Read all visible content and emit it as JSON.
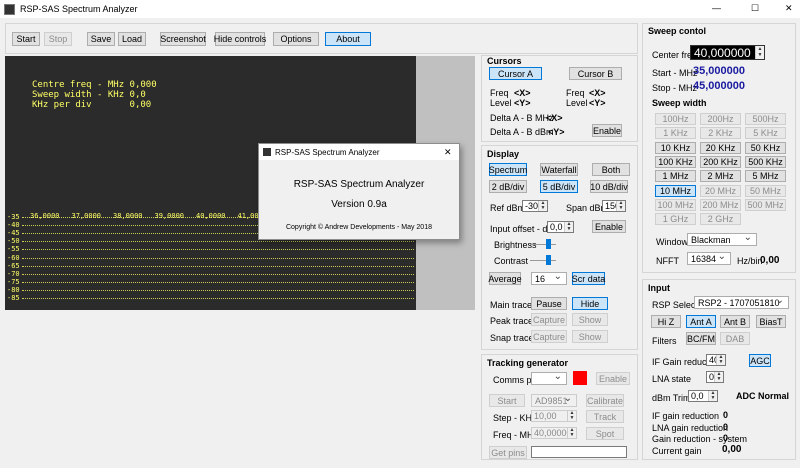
{
  "window": {
    "title": "RSP-SAS Spectrum Analyzer",
    "minimize": "—",
    "maximize": "☐",
    "close": "✕"
  },
  "toolbar": {
    "start": "Start",
    "stop": "Stop",
    "save": "Save",
    "load": "Load",
    "screenshot": "Screenshot",
    "hide_controls": "Hide controls",
    "options": "Options",
    "about": "About"
  },
  "chart": {
    "centre_freq": "Centre freq - MHz 0,000",
    "sweep_width": "Sweep width - KHz 0,0",
    "khz_per_div": "KHz per div       0,00",
    "y_labels": [
      "-35",
      "-40",
      "-45",
      "-50",
      "-55",
      "-60",
      "-65",
      "-70",
      "-75",
      "-80",
      "-85"
    ],
    "x_labels": [
      "36,0000",
      "37,0000",
      "38,0000",
      "39,0000",
      "40,0000",
      "41,000"
    ],
    "colors": {
      "bg": "#2b2b2b",
      "text": "#ffff66",
      "grid": "#cccc55"
    }
  },
  "about_dialog": {
    "title": "RSP-SAS Spectrum Analyzer",
    "close": "✕",
    "name": "RSP-SAS Spectrum Analyzer",
    "version": "Version 0.9a",
    "copyright": "Copyright © Andrew Developments - May 2018"
  },
  "cursors": {
    "title": "Cursors",
    "cursor_a": "Cursor A",
    "cursor_b": "Cursor B",
    "freq_a_label": "Freq",
    "freq_a_val": "<X>",
    "level_a_label": "Level",
    "level_a_val": "<Y>",
    "freq_b_label": "Freq",
    "freq_b_val": "<X>",
    "level_b_label": "Level",
    "level_b_val": "<Y>",
    "delta_mhz_label": "Delta A - B MHz",
    "delta_mhz_val": "<X>",
    "delta_dbm_label": "Delta A - B dBm",
    "delta_dbm_val": "<Y>",
    "enable": "Enable"
  },
  "display": {
    "title": "Display",
    "spectrum": "Spectrum",
    "waterfall": "Waterfall",
    "both": "Both",
    "div2": "2 dB/div",
    "div5": "5 dB/div",
    "div10": "10 dB/div",
    "ref_label": "Ref dBm",
    "ref_val": "-30",
    "span_label": "Span dBm",
    "span_val": "150",
    "offset_label": "Input offset - dBm",
    "offset_val": "0,0",
    "enable": "Enable",
    "brightness": "Brightness",
    "contrast": "Contrast",
    "average": "Average",
    "average_val": "16",
    "scr_data": "Scr data",
    "main_trace": "Main trace",
    "pause": "Pause",
    "hide": "Hide",
    "peak_trace": "Peak trace",
    "capture": "Capture",
    "show": "Show",
    "snap_trace": "Snap trace",
    "capture2": "Capture",
    "show2": "Show"
  },
  "tracking": {
    "title": "Tracking generator",
    "comms_port": "Comms port",
    "comms_val": "",
    "enable": "Enable",
    "start": "Start",
    "ad": "AD9851",
    "calibrate": "Calibrate",
    "step_label": "Step - KHz",
    "step_val": "10,00",
    "track": "Track",
    "freq_label": "Freq - MHz",
    "freq_val": "40,000000",
    "spot": "Spot",
    "get_pins": "Get pins",
    "pins_val": "",
    "status_color": "#ff0000"
  },
  "sweep": {
    "title": "Sweep contol",
    "center_label": "Center freq",
    "center_val": "40,000000",
    "start_label": "Start - MHz",
    "start_val": "35,000000",
    "stop_label": "Stop - MHz",
    "stop_val": "45,000000",
    "width_title": "Sweep width",
    "widths": [
      [
        "100Hz",
        "200Hz",
        "500Hz"
      ],
      [
        "1 KHz",
        "2 KHz",
        "5 KHz"
      ],
      [
        "10 KHz",
        "20 KHz",
        "50 KHz"
      ],
      [
        "100 KHz",
        "200 KHz",
        "500 KHz"
      ],
      [
        "1 MHz",
        "2 MHz",
        "5 MHz"
      ],
      [
        "10 MHz",
        "20 MHz",
        "50 MHz"
      ],
      [
        "100 MHz",
        "200 MHz",
        "500 MHz"
      ],
      [
        "1 GHz",
        "2 GHz",
        ""
      ]
    ],
    "window_label": "Window",
    "window_val": "Blackman",
    "nfft_label": "NFFT",
    "nfft_val": "16384",
    "hzbin_label": "Hz/bin",
    "hzbin_val": "0,00",
    "value_color": "#1a1aa0"
  },
  "input": {
    "title": "Input",
    "rsp_label": "RSP Select",
    "rsp_val": "RSP2 - 1707051810",
    "hiz": "Hi Z",
    "anta": "Ant A",
    "antb": "Ant B",
    "biast": "BiasT",
    "filters_label": "Filters",
    "bcfm": "BC/FM",
    "dab": "DAB",
    "if_label": "IF Gain reduction",
    "if_val": "40",
    "agc": "AGC",
    "lna_label": "LNA state",
    "lna_val": "0",
    "trim_label": "dBm Trim",
    "trim_val": "0,0",
    "adc": "ADC Normal",
    "if_red_label": "IF gain reduction",
    "if_red_val": "0",
    "lna_red_label": "LNA gain reduction",
    "lna_red_val": "0",
    "sys_red_label": "Gain reduction - system",
    "sys_red_val": "0",
    "cur_gain_label": "Current gain",
    "cur_gain_val": "0,00"
  }
}
